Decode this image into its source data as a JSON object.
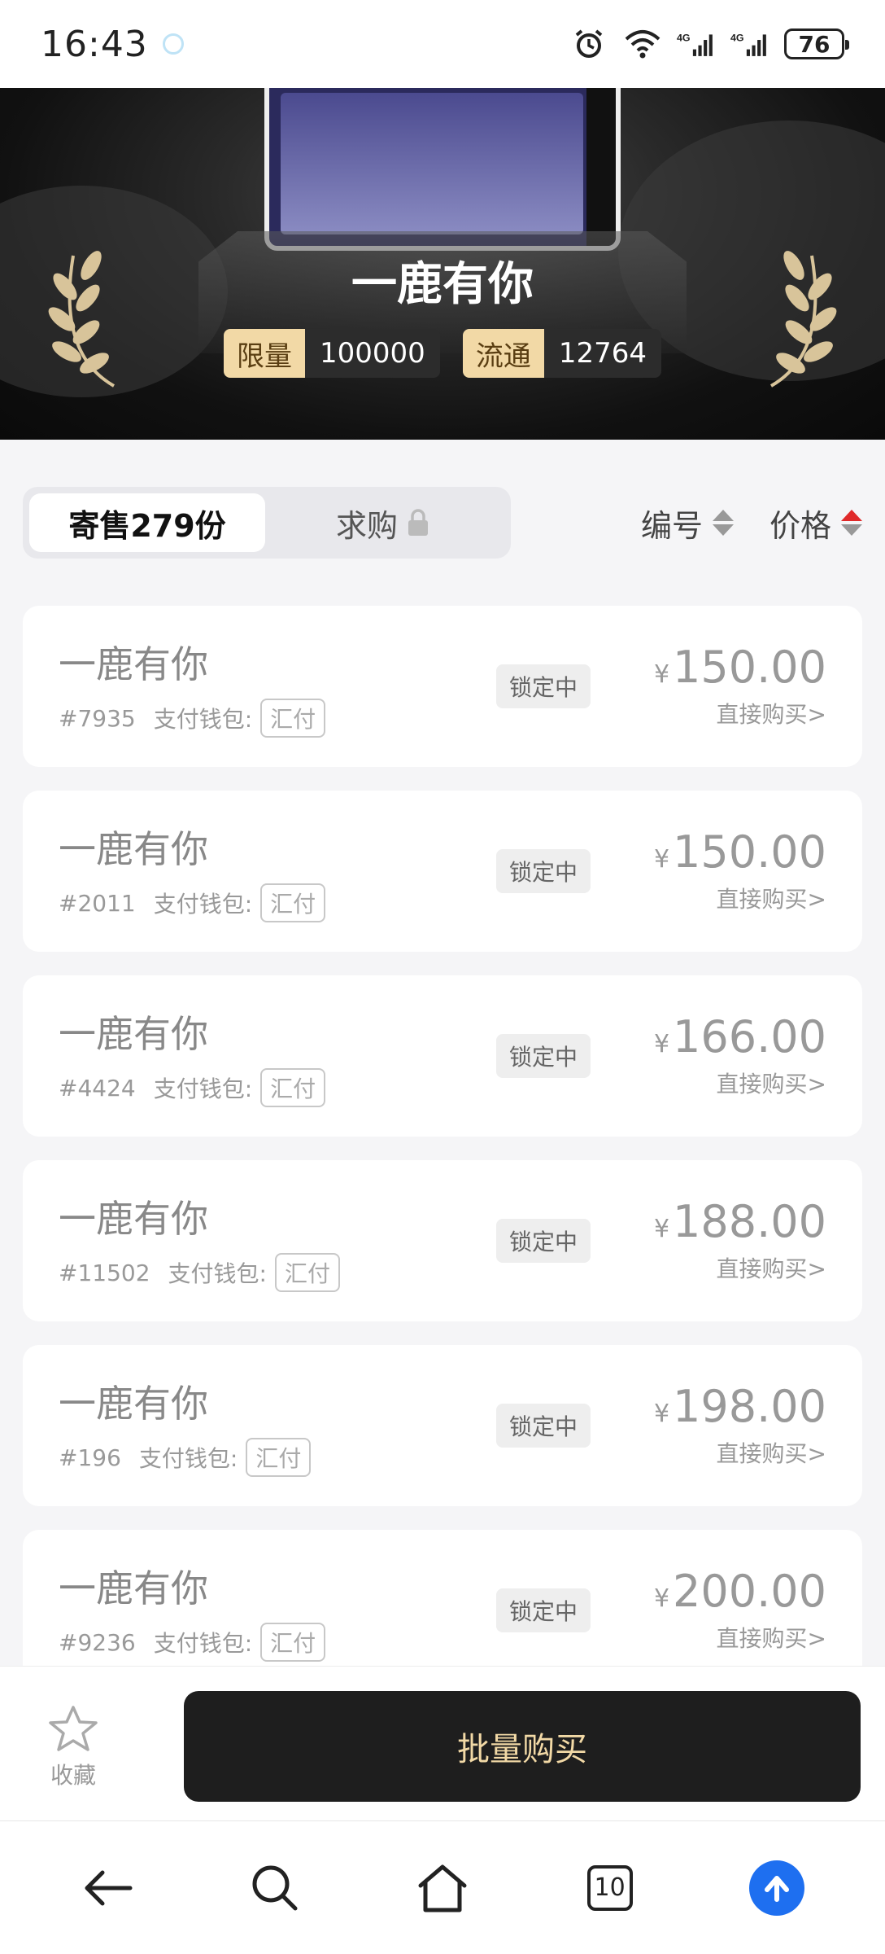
{
  "status_bar": {
    "time": "16:43",
    "battery": "76",
    "icons": [
      "alarm-icon",
      "wifi-icon",
      "signal-4g-icon",
      "signal-4g-icon",
      "battery-icon"
    ]
  },
  "hero": {
    "title": "一鹿有你",
    "stats": [
      {
        "label": "限量",
        "value": "100000"
      },
      {
        "label": "流通",
        "value": "12764"
      }
    ]
  },
  "tabs": [
    {
      "label": "寄售279份",
      "active": true
    },
    {
      "label": "求购",
      "active": false,
      "icon": "lock-icon"
    }
  ],
  "sort": [
    {
      "label": "编号",
      "state": "none"
    },
    {
      "label": "价格",
      "state": "ascending"
    }
  ],
  "listings": [
    {
      "title": "一鹿有你",
      "number": "#7935",
      "wallet_label": "支付钱包:",
      "wallet": "汇付",
      "status": "锁定中",
      "currency": "¥",
      "price": "150.00",
      "action": "直接购买>"
    },
    {
      "title": "一鹿有你",
      "number": "#2011",
      "wallet_label": "支付钱包:",
      "wallet": "汇付",
      "status": "锁定中",
      "currency": "¥",
      "price": "150.00",
      "action": "直接购买>"
    },
    {
      "title": "一鹿有你",
      "number": "#4424",
      "wallet_label": "支付钱包:",
      "wallet": "汇付",
      "status": "锁定中",
      "currency": "¥",
      "price": "166.00",
      "action": "直接购买>"
    },
    {
      "title": "一鹿有你",
      "number": "#11502",
      "wallet_label": "支付钱包:",
      "wallet": "汇付",
      "status": "锁定中",
      "currency": "¥",
      "price": "188.00",
      "action": "直接购买>"
    },
    {
      "title": "一鹿有你",
      "number": "#196",
      "wallet_label": "支付钱包:",
      "wallet": "汇付",
      "status": "锁定中",
      "currency": "¥",
      "price": "198.00",
      "action": "直接购买>"
    },
    {
      "title": "一鹿有你",
      "number": "#9236",
      "wallet_label": "支付钱包:",
      "wallet": "汇付",
      "status": "锁定中",
      "currency": "¥",
      "price": "200.00",
      "action": "直接购买>"
    }
  ],
  "action_bar": {
    "favorite_label": "收藏",
    "bulk_buy_label": "批量购买"
  },
  "nav": {
    "tab_count": "10",
    "icons": [
      "back-icon",
      "search-icon",
      "home-icon",
      "tabs-icon",
      "upload-icon"
    ]
  },
  "colors": {
    "accent_gold": "#f2d9a6",
    "dark": "#1e1e1e",
    "sort_active": "#e02a2a",
    "upload_blue": "#1e6ff0"
  }
}
